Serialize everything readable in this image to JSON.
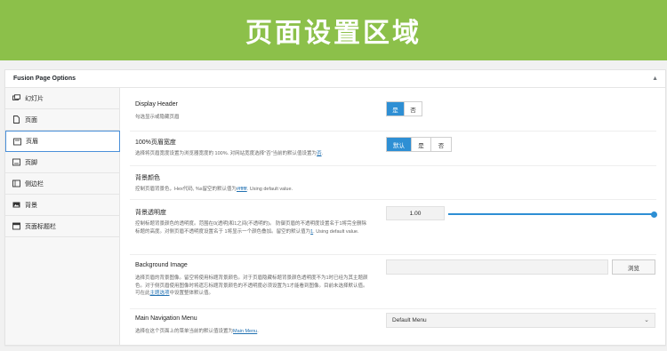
{
  "banner": {
    "title": "页面设置区域"
  },
  "panel": {
    "title": "Fusion Page Options",
    "toggle": "▲"
  },
  "tabs": [
    {
      "label": "幻灯片",
      "icon": "slideshow-icon"
    },
    {
      "label": "页面",
      "icon": "page-icon"
    },
    {
      "label": "页眉",
      "icon": "header-icon"
    },
    {
      "label": "页脚",
      "icon": "footer-icon"
    },
    {
      "label": "侧边栏",
      "icon": "sidebar-icon"
    },
    {
      "label": "背景",
      "icon": "image-icon"
    },
    {
      "label": "页面标题栏",
      "icon": "title-bar-icon"
    }
  ],
  "active_tab": "页眉",
  "options": {
    "display_header": {
      "label": "Display Header",
      "desc": "勾选显示或隐藏页眉",
      "yes": "是",
      "no": "否",
      "selected": "是"
    },
    "full_width_header": {
      "label": "100%页眉宽度",
      "desc_pre": "选择将页眉宽度设置为浏览器宽度的 100%. 对网站宽度选择\"否\"当前的默认值设置为",
      "desc_link": "否",
      "desc_post": ".",
      "default": "默认",
      "yes": "是",
      "no": "否",
      "selected": "默认"
    },
    "bg_color": {
      "label": "背景颜色",
      "desc_pre": "控制页眉背景色，Hex代码, %s留空的默认值为",
      "desc_link": "#ffffff",
      "desc_post": ". Using default value."
    },
    "bg_opacity": {
      "label": "背景透明度",
      "desc_pre": "控制标题背景颜色的透明度。范围在0(透明)和1之间(不透明的)。 防御页眉的不透明度设置名于1将完全删除标题的高度。对侧页眉不透明度设置名于 1将显示一个颜色叠加。留空的默认值为",
      "desc_link": "1",
      "desc_post": ". Using default value.",
      "value": "1.00",
      "level": 1.0
    },
    "bg_image": {
      "label": "Background Image",
      "desc_pre": "选择页眉的背景图像。留空将使用标题背景颜色。对于页眉隐藏标题背景颜色透明度不为1时已经为其主题颜色。对于侧页眉使用图像时将遗忘标题背景颜色的不透明度必须设置为1才能看到图像。目前未选择默认值。 可在此",
      "desc_link": "主题选项",
      "desc_post": "中设置整体默认值。",
      "button": "浏览"
    },
    "main_menu": {
      "label": "Main Navigation Menu",
      "desc_pre": "选择在这个页面上的菜单当前的默认值设置为",
      "desc_link": "Main Menu",
      "desc_post": ".",
      "value": "Default Menu",
      "chevron": "⌄"
    }
  }
}
